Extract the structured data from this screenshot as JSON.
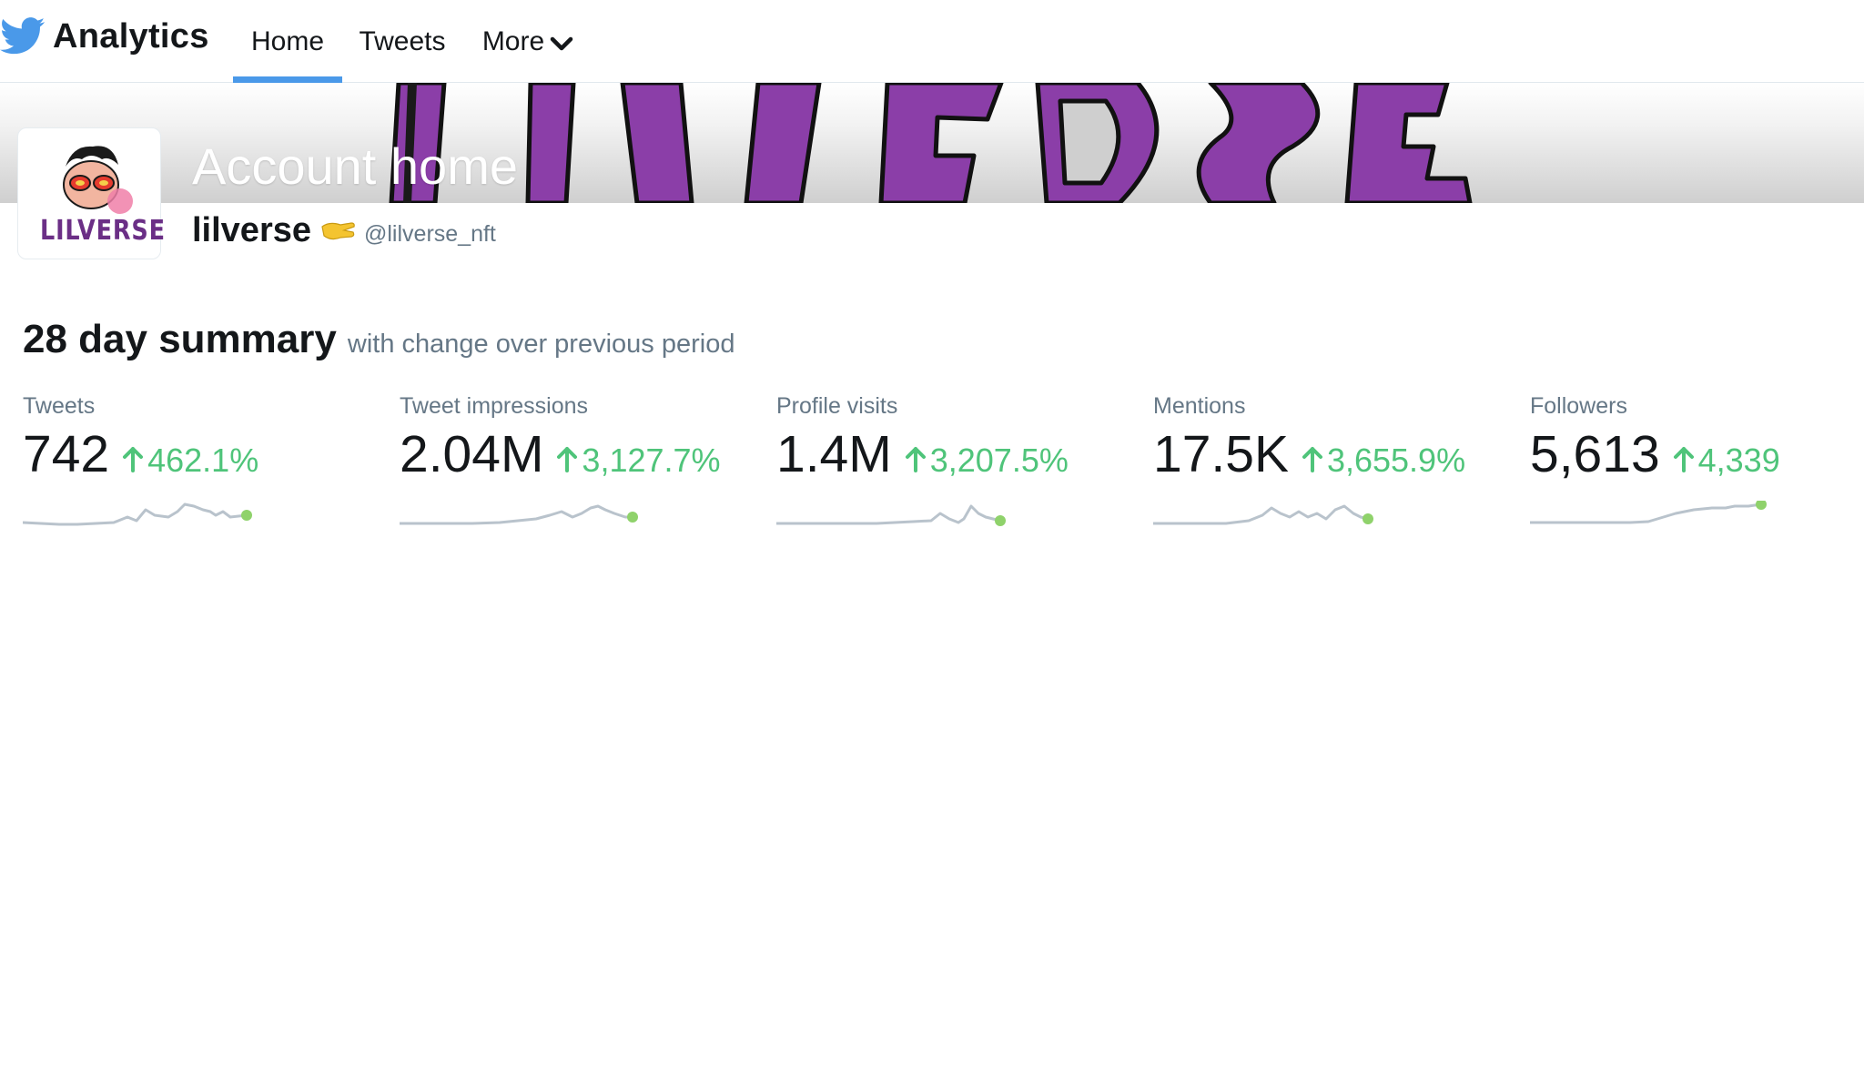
{
  "nav": {
    "brand": "Analytics",
    "tabs": [
      {
        "label": "Home",
        "active": true
      },
      {
        "label": "Tweets",
        "active": false
      },
      {
        "label": "More",
        "active": false
      }
    ]
  },
  "page": {
    "title": "Account home"
  },
  "profile": {
    "name": "lilverse",
    "handle": "@lilverse_nft",
    "name_emoji": "pinching-hand",
    "banner_text": "LILVERSE",
    "avatar_text": "LILVERSE"
  },
  "summary": {
    "title": "28 day summary",
    "subtitle": "with change over previous period",
    "stats": [
      {
        "label": "Tweets",
        "value": "742",
        "change": "462.1%"
      },
      {
        "label": "Tweet impressions",
        "value": "2.04M",
        "change": "3,127.7%"
      },
      {
        "label": "Profile visits",
        "value": "1.4M",
        "change": "3,207.5%"
      },
      {
        "label": "Mentions",
        "value": "17.5K",
        "change": "3,655.9%"
      },
      {
        "label": "Followers",
        "value": "5,613",
        "change": "4,339"
      }
    ]
  },
  "colors": {
    "accent": "#4a99e9",
    "positive": "#4fc47a",
    "muted_text": "#657786",
    "sparkline": "#b9c3cc",
    "sparkline_dot": "#8fd26b",
    "banner_purple": "#8b3ea8"
  }
}
